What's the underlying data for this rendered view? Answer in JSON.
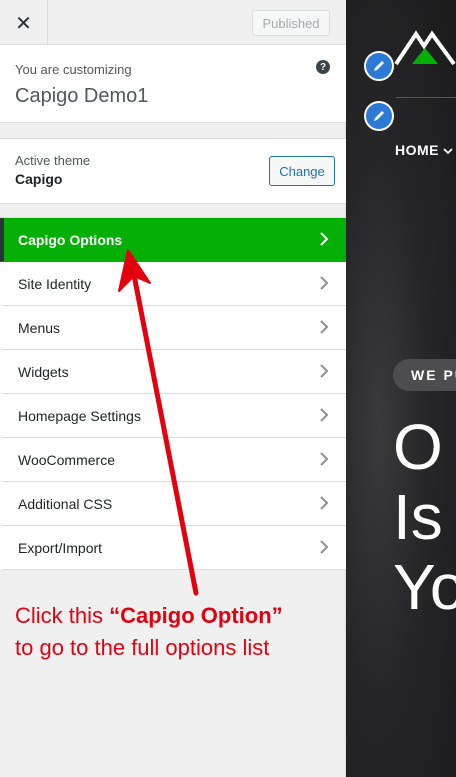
{
  "topbar": {
    "close_glyph": "✕",
    "published_label": "Published"
  },
  "info": {
    "subtitle": "You are customizing",
    "site_title": "Capigo Demo1",
    "help_glyph": "?"
  },
  "theme": {
    "subtitle": "Active theme",
    "name": "Capigo",
    "change_label": "Change"
  },
  "menu": [
    {
      "label": "Capigo Options",
      "active": true
    },
    {
      "label": "Site Identity"
    },
    {
      "label": "Menus"
    },
    {
      "label": "Widgets"
    },
    {
      "label": "Homepage Settings"
    },
    {
      "label": "WooCommerce"
    },
    {
      "label": "Additional CSS"
    },
    {
      "label": "Export/Import"
    }
  ],
  "annotation": {
    "prefix": "Click this ",
    "highlight": "“Capigo Option”",
    "suffix": "to go to the full options list",
    "color": "#e3000f"
  },
  "preview": {
    "nav_home": "HOME",
    "pill_text": "WE PU",
    "hero_lines": [
      "O",
      "Is",
      "Yo"
    ]
  },
  "colors": {
    "accent_green": "#05b006",
    "link_blue": "#2271b1"
  }
}
